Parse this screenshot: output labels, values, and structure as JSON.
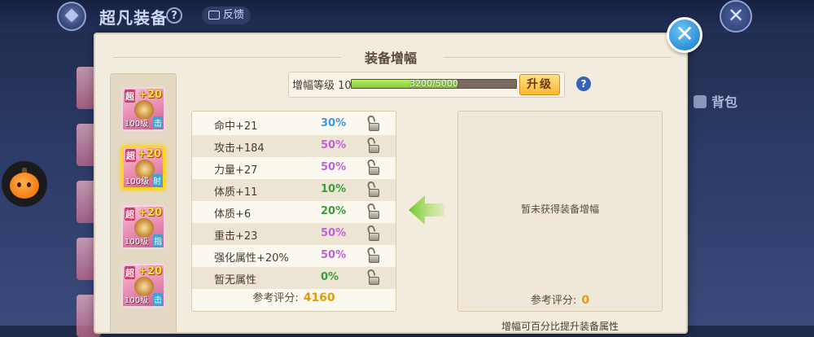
{
  "top": {
    "title": "超凡装备",
    "help": "?",
    "feedback": "反馈",
    "close": "✕"
  },
  "side": {
    "backpack": "背包"
  },
  "panel": {
    "title": "装备增幅",
    "close": "✕"
  },
  "items": [
    {
      "super": "超",
      "plus": "+20",
      "level": "100级",
      "tag": "击",
      "selected": false
    },
    {
      "super": "超",
      "plus": "+20",
      "level": "100级",
      "tag": "射",
      "selected": true
    },
    {
      "super": "超",
      "plus": "+20",
      "level": "100级",
      "tag": "指",
      "selected": false
    },
    {
      "super": "超",
      "plus": "+20",
      "level": "100级",
      "tag": "击",
      "selected": false
    }
  ],
  "level": {
    "label": "增幅等级 10",
    "progress_text": "3200/5000",
    "progress_fraction": 0.64,
    "upgrade": "升级",
    "help": "?"
  },
  "stats": [
    {
      "name": "命中+21",
      "pct": "30%",
      "color": "#3b9be0"
    },
    {
      "name": "攻击+184",
      "pct": "50%",
      "color": "#c55fd8"
    },
    {
      "name": "力量+27",
      "pct": "50%",
      "color": "#c55fd8"
    },
    {
      "name": "体质+11",
      "pct": "10%",
      "color": "#3a9d3a"
    },
    {
      "name": "体质+6",
      "pct": "20%",
      "color": "#3a9d3a"
    },
    {
      "name": "重击+23",
      "pct": "50%",
      "color": "#c55fd8"
    },
    {
      "name": "强化属性+20%",
      "pct": "50%",
      "color": "#c55fd8"
    },
    {
      "name": "暂无属性",
      "pct": "0%",
      "color": "#3a9d3a"
    }
  ],
  "score": {
    "label": "参考评分:",
    "value": "4160"
  },
  "right": {
    "empty_text": "暂未获得装备增幅",
    "score_label": "参考评分:",
    "score_value": "0",
    "bottom_note": "增幅可百分比提升装备属性"
  }
}
